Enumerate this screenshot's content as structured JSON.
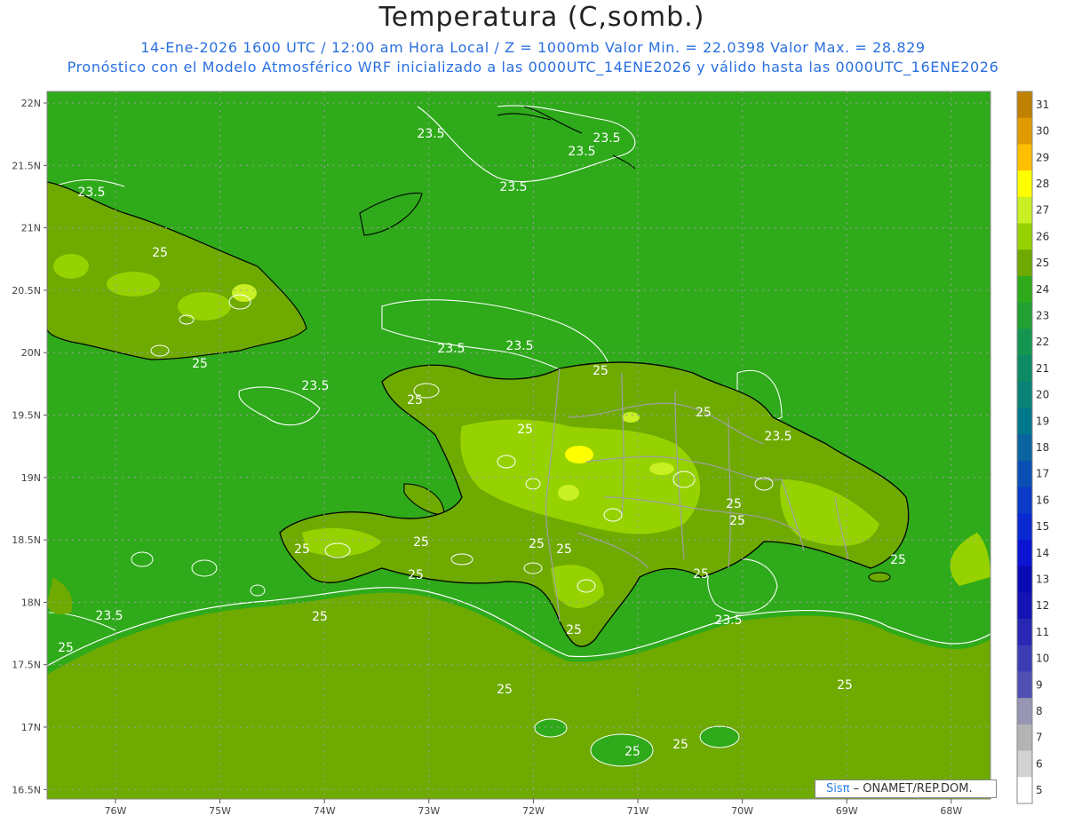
{
  "header": {
    "title": "Temperatura (C,somb.)",
    "line1": "14-Ene-2026 1600 UTC / 12:00 am Hora Local / Z = 1000mb   Valor Min. = 22.0398  Valor Max. = 28.829",
    "line2": "Pronóstico con el Modelo Atmosférico WRF inicializado a las 0000UTC_14ENE2026 y válido hasta las  0000UTC_16ENE2026"
  },
  "axes": {
    "lat_labels": [
      "22N",
      "21.5N",
      "21N",
      "20.5N",
      "20N",
      "19.5N",
      "19N",
      "18.5N",
      "18N",
      "17.5N",
      "17N",
      "16.5N"
    ],
    "lon_labels": [
      "76W",
      "75W",
      "74W",
      "73W",
      "72W",
      "71W",
      "70W",
      "69W",
      "68W"
    ]
  },
  "colorbar": {
    "labels": [
      "31",
      "30",
      "29",
      "28",
      "27",
      "26",
      "25",
      "24",
      "23",
      "22",
      "21",
      "20",
      "19",
      "18",
      "17",
      "16",
      "15",
      "14",
      "13",
      "12",
      "11",
      "10",
      "9",
      "8",
      "7",
      "6",
      "5"
    ],
    "colors": [
      "#c08000",
      "#e09a00",
      "#ffbf00",
      "#ffff00",
      "#c8f024",
      "#96d200",
      "#6eaa00",
      "#2eaa1a",
      "#22a032",
      "#149650",
      "#0c8c64",
      "#0a8278",
      "#00788c",
      "#0a64a0",
      "#0a50b4",
      "#0a3cc8",
      "#0a28d2",
      "#0a14d2",
      "#0a0ab4",
      "#1414b4",
      "#2828b4",
      "#3c3cb4",
      "#5050b4",
      "#9696b4",
      "#b4b4b4",
      "#d2d2d2",
      "#ffffff"
    ]
  },
  "contour_labels": {
    "north": [
      "23.5",
      "23.5",
      "23.5",
      "23.5",
      "23.5",
      "23.5",
      "23.5"
    ],
    "island": [
      "25",
      "25",
      "25",
      "25",
      "25",
      "25",
      "25",
      "25",
      "25",
      "25",
      "25",
      "25",
      "25",
      "25",
      "23.5"
    ],
    "south": [
      "25",
      "25",
      "25",
      "25",
      "25",
      "25",
      "25",
      "25",
      "23.5",
      "23.5",
      "23.5"
    ]
  },
  "credit": {
    "part1": "Sisπ",
    "part2": " – ONAMET/REP.DOM."
  },
  "colors": {
    "sea": "#2eaa1a",
    "warm_sea": "#6eaa00",
    "land": "#6eaa00",
    "hot": "#96d200",
    "hotter": "#c8f024"
  }
}
